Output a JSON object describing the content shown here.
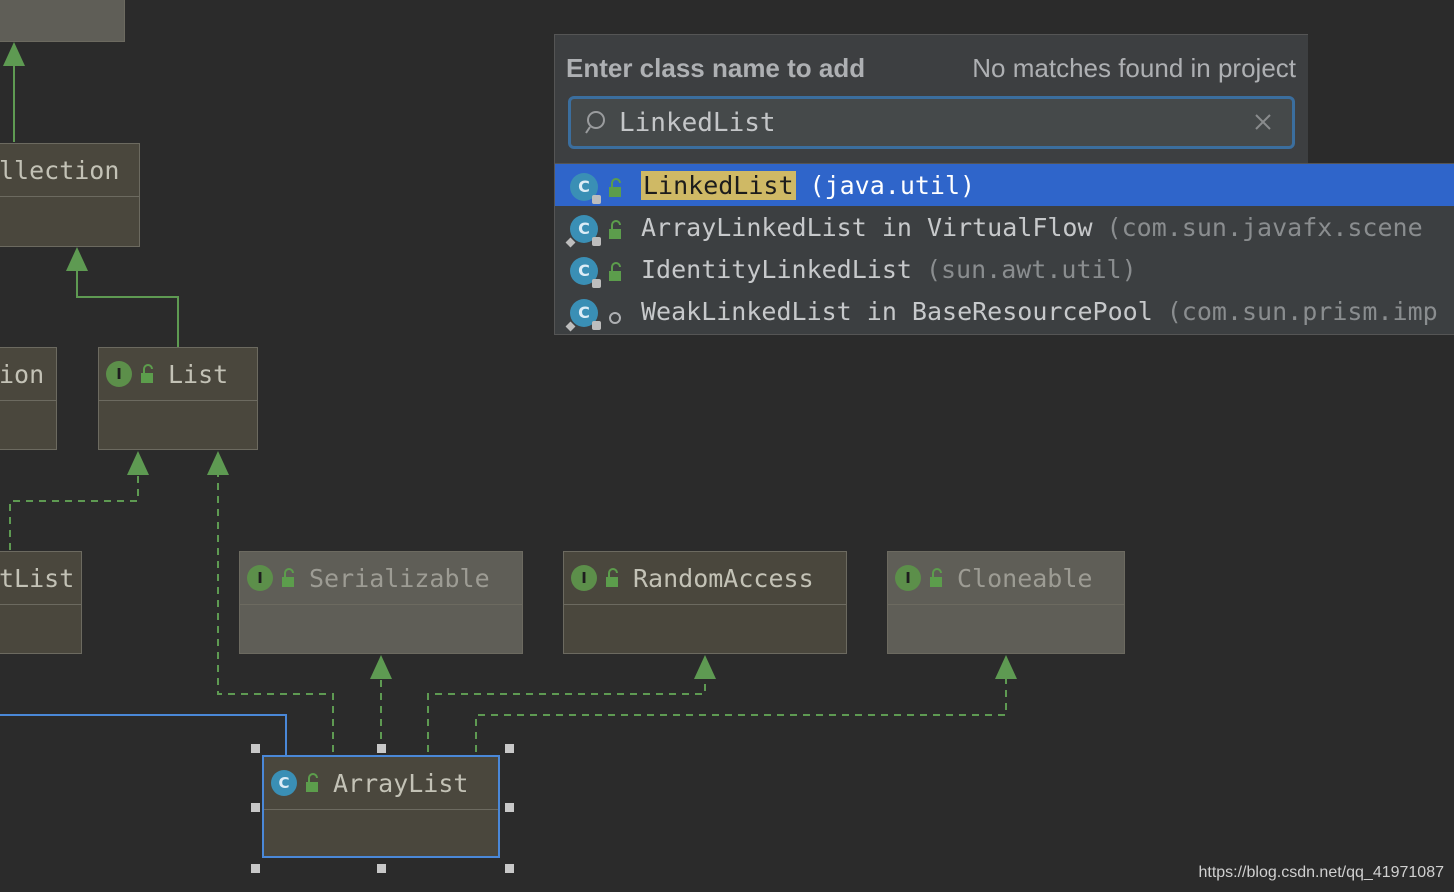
{
  "diagram": {
    "nodes": {
      "collection": {
        "name": "llection"
      },
      "collection_left": {
        "name": "ion"
      },
      "list": {
        "badge": "I",
        "name": "List"
      },
      "abstract_list": {
        "name": "tList"
      },
      "serializable": {
        "badge": "I",
        "name": "Serializable"
      },
      "random_access": {
        "badge": "I",
        "name": "RandomAccess"
      },
      "cloneable": {
        "badge": "I",
        "name": "Cloneable"
      },
      "array_list": {
        "badge": "C",
        "name": "ArrayList"
      }
    },
    "colors": {
      "background": "#2b2b2b",
      "node_fill": "#4a473d",
      "arrow": "#5e9a52",
      "selection": "#4a88d8"
    }
  },
  "popup": {
    "title": "Enter class name to add",
    "status": "No matches found in project",
    "search_value": "LinkedList",
    "results": [
      {
        "badge": "C",
        "match": "LinkedList",
        "rest": "",
        "pkg": "(java.util)",
        "selected": true,
        "visibility": "lock-icon"
      },
      {
        "badge": "C",
        "match": "",
        "rest": "ArrayLinkedList in VirtualFlow",
        "pkg": "(com.sun.javafx.scene",
        "selected": false,
        "visibility": "lock-icon"
      },
      {
        "badge": "C",
        "match": "",
        "rest": "IdentityLinkedList",
        "pkg": "(sun.awt.util)",
        "selected": false,
        "visibility": "lock-icon"
      },
      {
        "badge": "C",
        "match": "",
        "rest": "WeakLinkedList in BaseResourcePool",
        "pkg": "(com.sun.prism.imp",
        "selected": false,
        "visibility": "package-private-icon"
      }
    ]
  },
  "watermark": "https://blog.csdn.net/qq_41971087"
}
